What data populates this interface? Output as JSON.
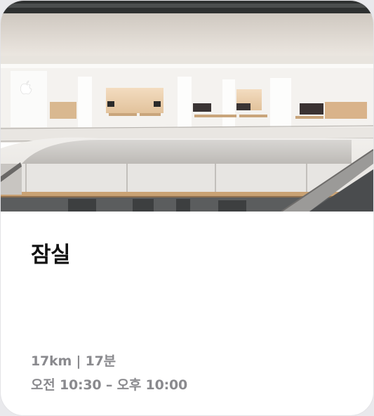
{
  "store": {
    "name": "잠실",
    "distance": "17km | 17분",
    "hours": "오전 10:30 – 오후 10:00"
  },
  "photo": {
    "icon": "apple-logo-icon"
  }
}
